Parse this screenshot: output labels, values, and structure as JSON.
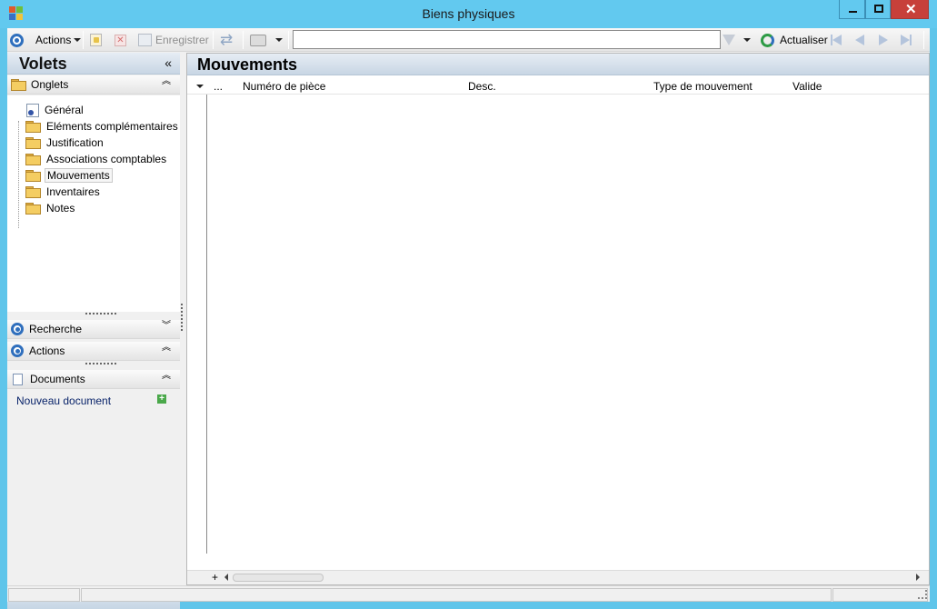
{
  "window": {
    "title": "Biens physiques"
  },
  "toolbar": {
    "actions_label": "Actions",
    "save_label": "Enregistrer",
    "search_value": "",
    "refresh_label": "Actualiser"
  },
  "left_pane": {
    "title": "Volets",
    "tabs_section": {
      "label": "Onglets",
      "items": [
        {
          "label": "Général",
          "icon": "document-gear-icon"
        },
        {
          "label": "Eléments complémentaires",
          "icon": "folder-icon"
        },
        {
          "label": "Justification",
          "icon": "folder-icon"
        },
        {
          "label": "Associations comptables",
          "icon": "folder-icon"
        },
        {
          "label": "Mouvements",
          "icon": "folder-open-icon",
          "selected": true
        },
        {
          "label": "Inventaires",
          "icon": "folder-icon"
        },
        {
          "label": "Notes",
          "icon": "folder-icon"
        }
      ]
    },
    "search_section": {
      "label": "Recherche"
    },
    "actions_section": {
      "label": "Actions"
    },
    "documents_section": {
      "label": "Documents",
      "new_document_label": "Nouveau document"
    }
  },
  "main": {
    "title": "Mouvements",
    "grid": {
      "columns": [
        "...",
        "Numéro de pièce",
        "Desc.",
        "Type de mouvement",
        "Valide"
      ],
      "rows": []
    }
  },
  "colors": {
    "title_bar": "#62c9ef",
    "close_button": "#c7403a",
    "pane_header": "#c8d6e4",
    "accent_blue": "#2f6fbd",
    "link_blue": "#0a246a"
  }
}
